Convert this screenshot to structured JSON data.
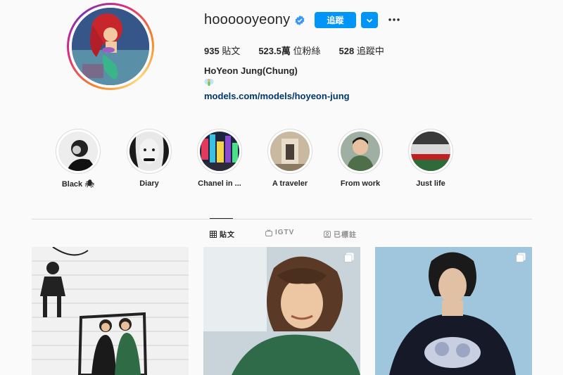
{
  "profile": {
    "username": "hoooooyeony",
    "follow_label": "追蹤",
    "stats": {
      "posts_count": "935",
      "posts_label": " 貼文",
      "followers_count": "523.5萬",
      "followers_label": " 位粉絲",
      "following_count": "528",
      "following_label": " 追蹤中"
    },
    "full_name": "HoYeon Jung(Chung)",
    "link": "models.com/models/hoyeon-jung"
  },
  "highlights": [
    {
      "label": "Black 🕷"
    },
    {
      "label": "Diary"
    },
    {
      "label": "Chanel in ..."
    },
    {
      "label": "A traveler"
    },
    {
      "label": "From work"
    },
    {
      "label": "Just life"
    }
  ],
  "tabs": [
    {
      "label": "貼文"
    },
    {
      "label": "IGTV"
    },
    {
      "label": "已標註"
    }
  ],
  "colors": {
    "accent": "#0095f6",
    "link": "#00376b",
    "verified": "#3897f0"
  }
}
